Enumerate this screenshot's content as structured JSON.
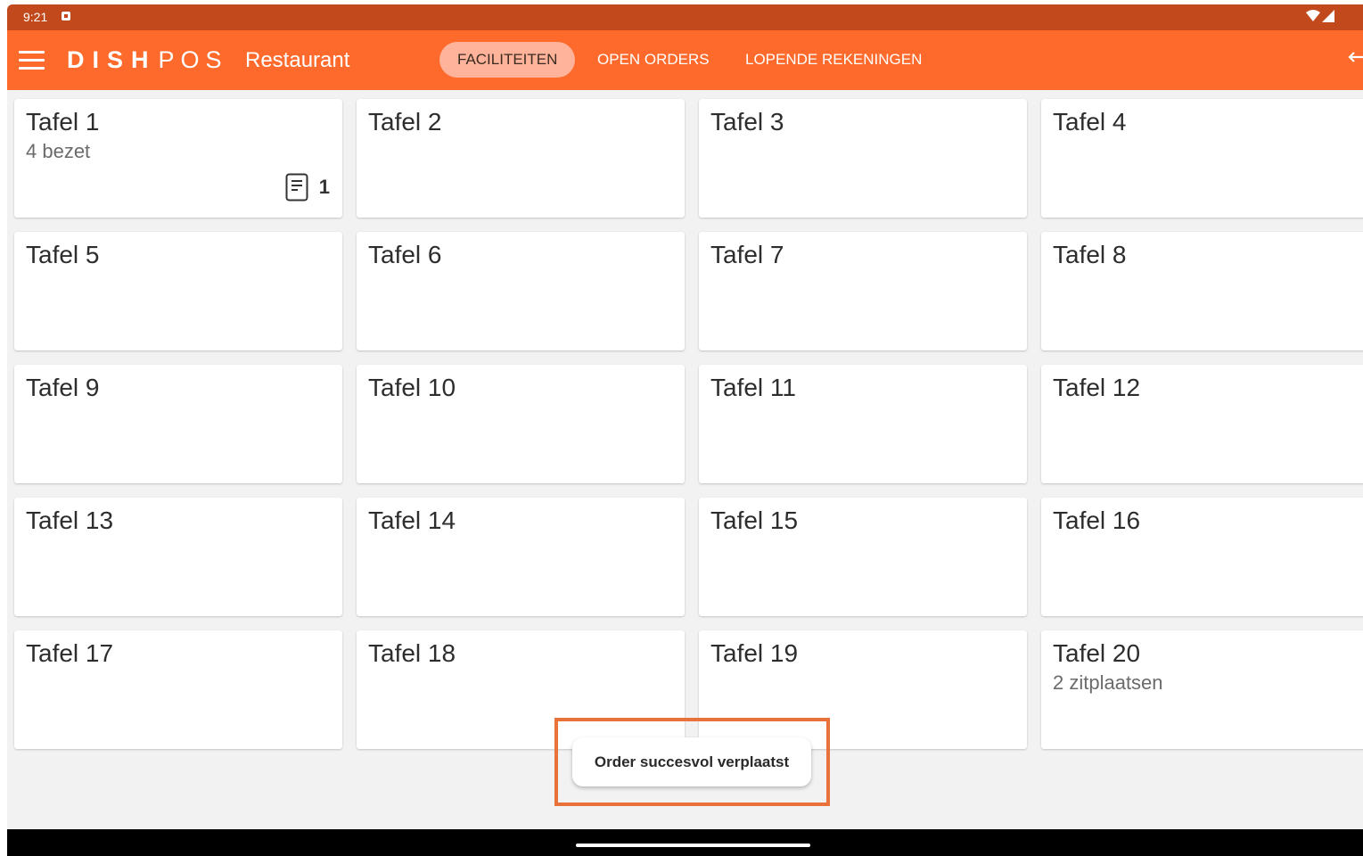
{
  "status_bar": {
    "time": "9:21"
  },
  "app_bar": {
    "brand_dish": "DISH",
    "brand_pos": "POS",
    "subtitle": "Restaurant",
    "tabs": [
      {
        "label": "FACILITEITEN",
        "active": true
      },
      {
        "label": "OPEN ORDERS",
        "active": false
      },
      {
        "label": "LOPENDE REKENINGEN",
        "active": false
      }
    ]
  },
  "tables": [
    {
      "name": "Tafel 1",
      "status": "4 bezet",
      "orders": "1"
    },
    {
      "name": "Tafel 2"
    },
    {
      "name": "Tafel 3"
    },
    {
      "name": "Tafel 4"
    },
    {
      "name": "Tafel 5"
    },
    {
      "name": "Tafel 6"
    },
    {
      "name": "Tafel 7"
    },
    {
      "name": "Tafel 8"
    },
    {
      "name": "Tafel 9"
    },
    {
      "name": "Tafel 10"
    },
    {
      "name": "Tafel 11"
    },
    {
      "name": "Tafel 12"
    },
    {
      "name": "Tafel 13"
    },
    {
      "name": "Tafel 14"
    },
    {
      "name": "Tafel 15"
    },
    {
      "name": "Tafel 16"
    },
    {
      "name": "Tafel 17"
    },
    {
      "name": "Tafel 18"
    },
    {
      "name": "Tafel 19"
    },
    {
      "name": "Tafel 20",
      "status": "2 zitplaatsen"
    }
  ],
  "toast": {
    "message": "Order succesvol verplaatst"
  },
  "colors": {
    "status_bar": "#c1491c",
    "app_bar": "#fd6a2b",
    "active_tab": "#ffb39a",
    "highlight": "#e8723a"
  }
}
